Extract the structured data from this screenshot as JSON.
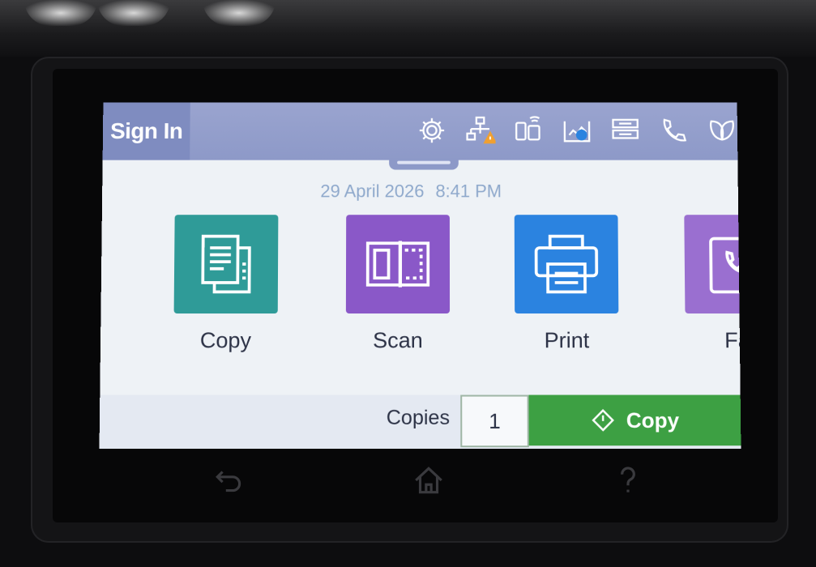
{
  "header": {
    "sign_in_label": "Sign In",
    "status_icons": [
      "gear-icon",
      "network-warning-icon",
      "wireless-direct-icon",
      "ink-levels-icon",
      "tray-icon",
      "fax-phone-icon",
      "eco-leaf-icon"
    ]
  },
  "datetime": {
    "date": "29 April 2026",
    "time": "8:41 PM"
  },
  "apps": [
    {
      "label": "Copy",
      "icon": "copy-icon",
      "color": "#2f9b98"
    },
    {
      "label": "Scan",
      "icon": "scan-icon",
      "color": "#8a58c8"
    },
    {
      "label": "Print",
      "icon": "print-icon",
      "color": "#2b83e0"
    },
    {
      "label": "Fa",
      "icon": "fax-icon",
      "color": "#9a6fd0"
    }
  ],
  "bottom_bar": {
    "copies_label": "Copies",
    "copies_value": "1",
    "copy_button_label": "Copy",
    "copy_button_color": "#3da043"
  },
  "hardware_buttons": [
    "back-icon",
    "home-icon",
    "help-icon"
  ]
}
